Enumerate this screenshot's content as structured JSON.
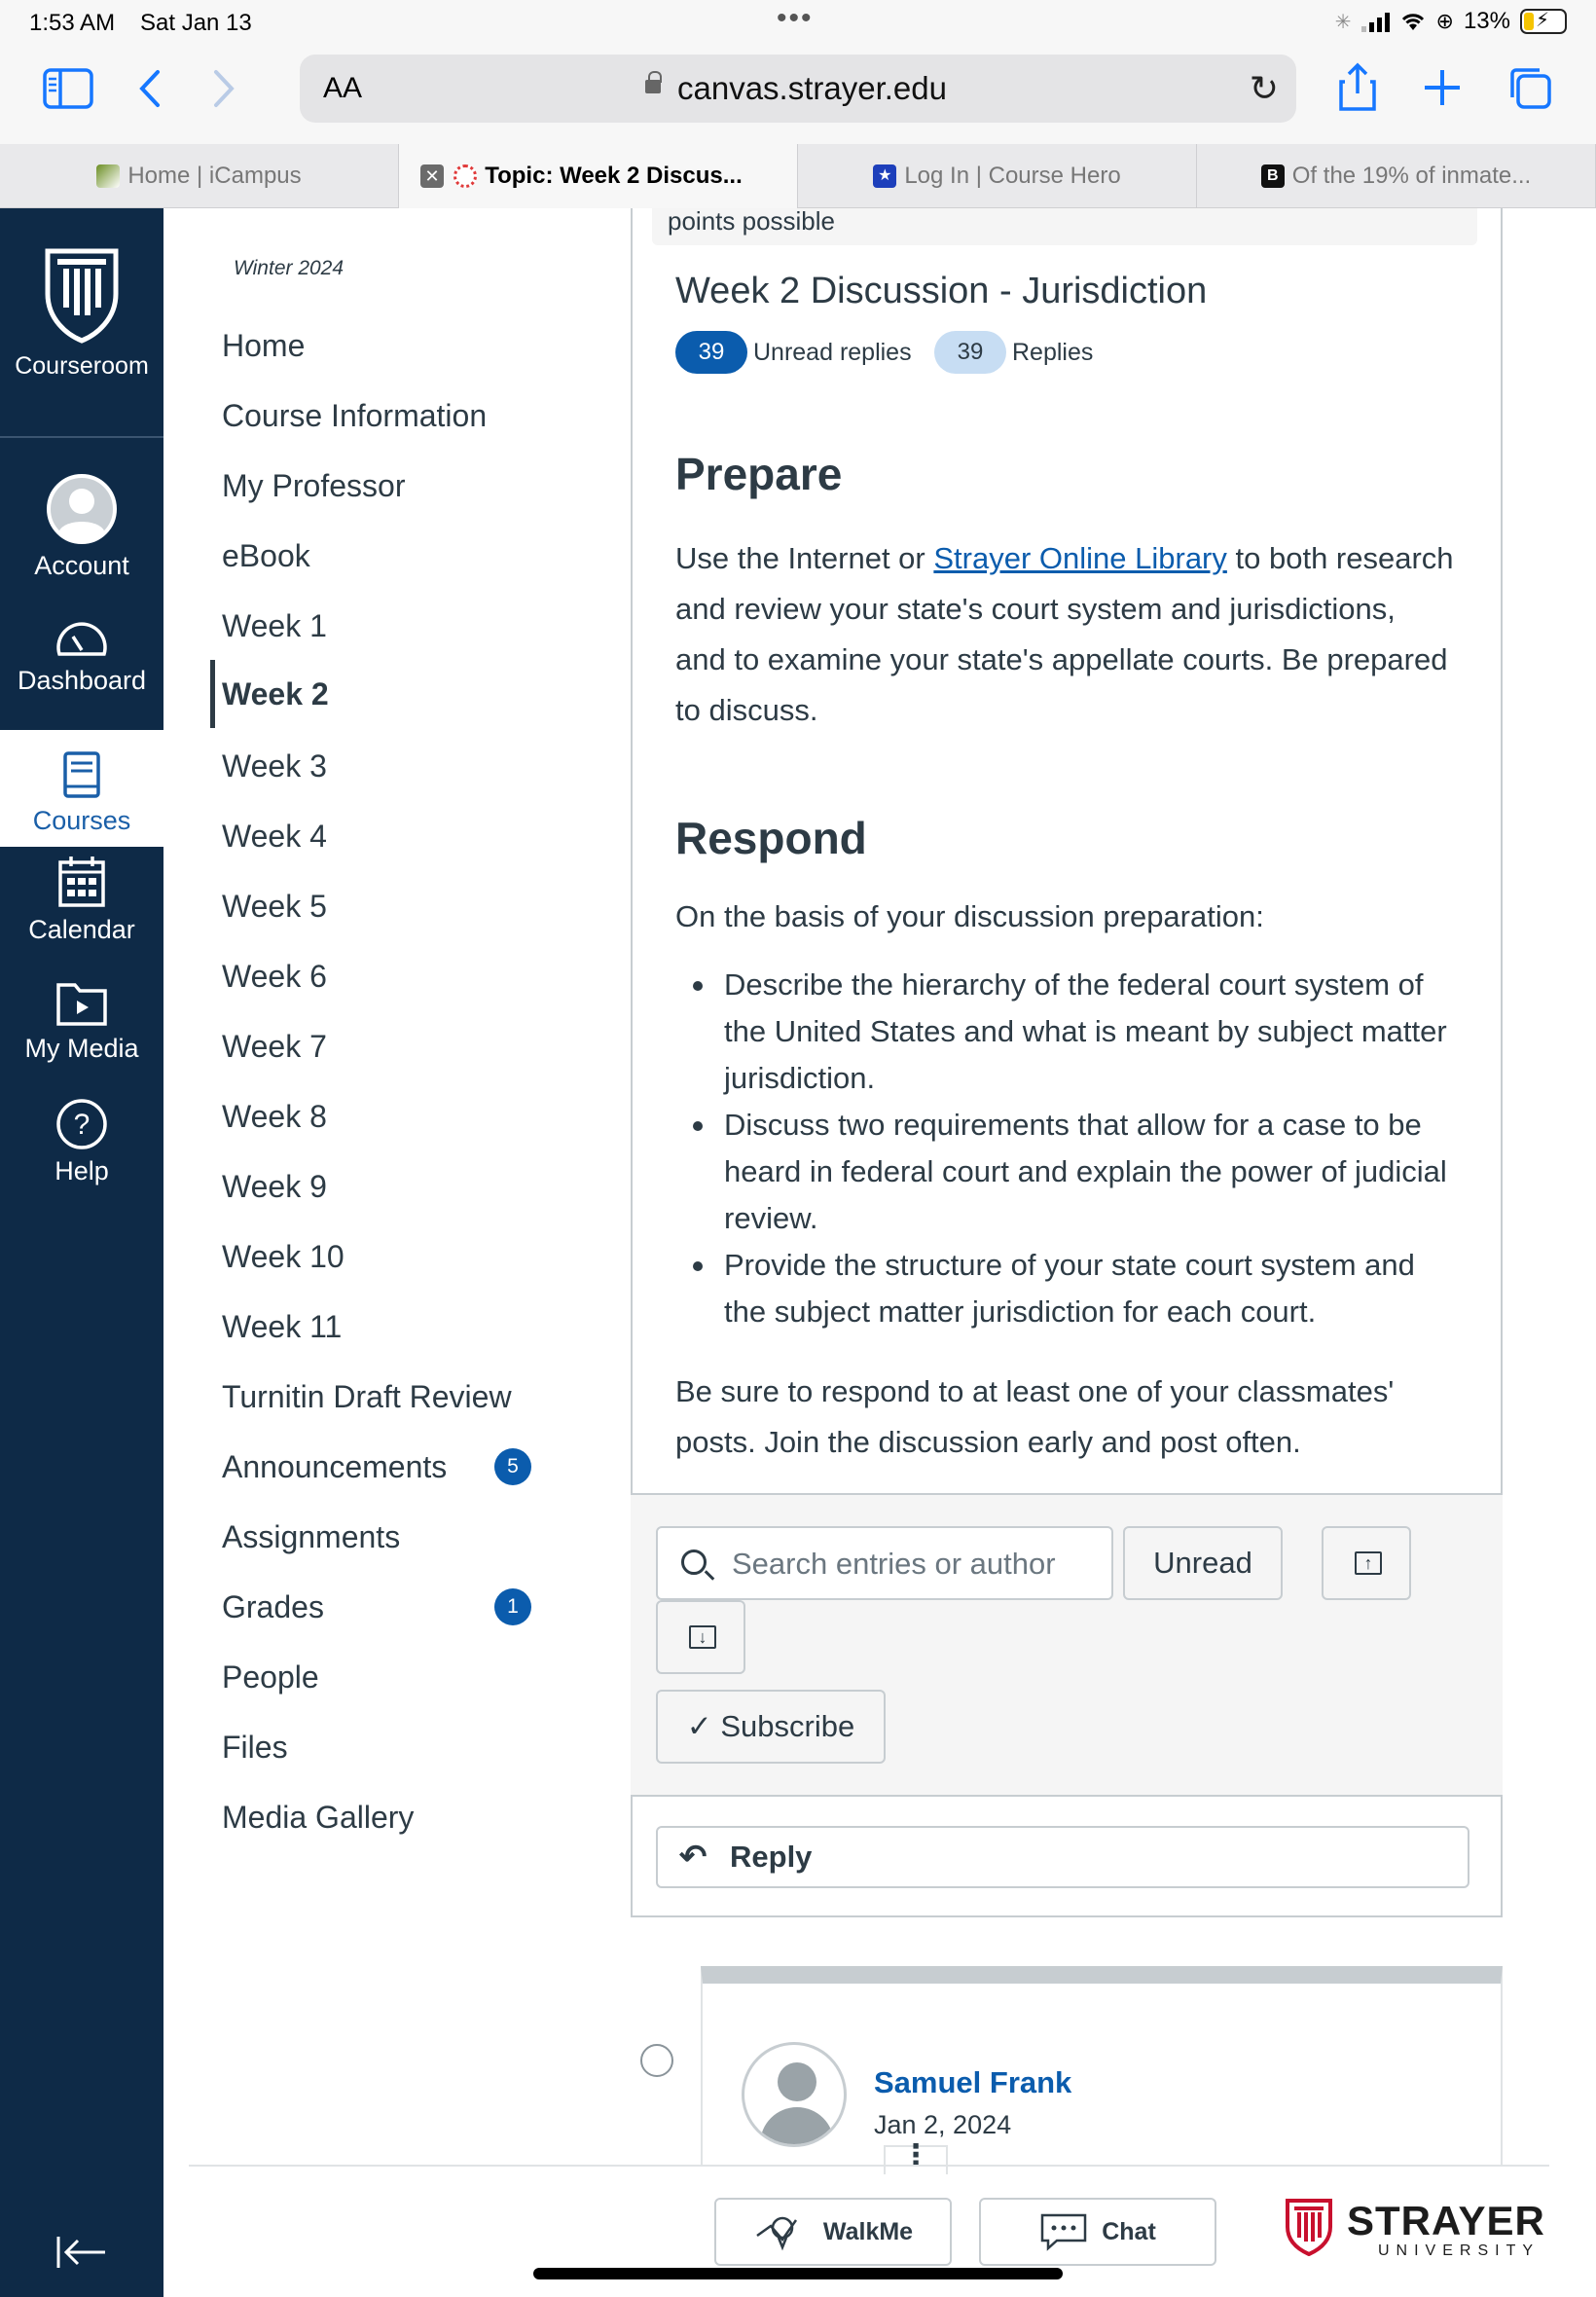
{
  "status_bar": {
    "time": "1:53 AM",
    "date": "Sat Jan 13",
    "battery": "13%"
  },
  "browser": {
    "text_size_label": "AA",
    "url": "canvas.strayer.edu",
    "tabs": [
      {
        "label": "Home | iCampus",
        "active": false
      },
      {
        "label": "Topic: Week 2 Discus...",
        "active": true
      },
      {
        "label": "Log In | Course Hero",
        "active": false
      },
      {
        "label": "Of the 19% of inmate...",
        "active": false
      }
    ]
  },
  "global_nav": {
    "brand_label": "Courseroom",
    "items": [
      {
        "label": "Account",
        "icon": "account-avatar-icon"
      },
      {
        "label": "Dashboard",
        "icon": "dashboard-gauge-icon"
      },
      {
        "label": "Courses",
        "icon": "courses-book-icon",
        "active": true
      },
      {
        "label": "Calendar",
        "icon": "calendar-icon"
      },
      {
        "label": "My Media",
        "icon": "media-folder-icon"
      },
      {
        "label": "Help",
        "icon": "help-question-icon"
      }
    ],
    "collapse_icon": "collapse-arrow-icon"
  },
  "course_nav": {
    "term": "Winter 2024",
    "items": [
      {
        "label": "Home"
      },
      {
        "label": "Course Information"
      },
      {
        "label": "My Professor"
      },
      {
        "label": "eBook"
      },
      {
        "label": "Week 1"
      },
      {
        "label": "Week 2",
        "active": true
      },
      {
        "label": "Week 3"
      },
      {
        "label": "Week 4"
      },
      {
        "label": "Week 5"
      },
      {
        "label": "Week 6"
      },
      {
        "label": "Week 7"
      },
      {
        "label": "Week 8"
      },
      {
        "label": "Week 9"
      },
      {
        "label": "Week 10"
      },
      {
        "label": "Week 11"
      },
      {
        "label": "Turnitin Draft Review"
      },
      {
        "label": "Announcements",
        "badge": "5"
      },
      {
        "label": "Assignments"
      },
      {
        "label": "Grades",
        "badge": "1"
      },
      {
        "label": "People"
      },
      {
        "label": "Files"
      },
      {
        "label": "Media Gallery"
      }
    ]
  },
  "discussion": {
    "points_text": "points possible",
    "title": "Week 2 Discussion - Jurisdiction",
    "unread_count": "39",
    "unread_label": "Unread replies",
    "replies_count": "39",
    "replies_label": "Replies",
    "prepare_heading": "Prepare",
    "prepare_text_before": "Use the Internet or ",
    "prepare_link": "Strayer Online Library",
    "prepare_text_after": " to both research and review your state's court system and jurisdictions, and to examine your state's appellate courts. Be prepared to discuss.",
    "respond_heading": "Respond",
    "respond_intro": "On the basis of your discussion preparation:",
    "bullets": [
      "Describe the hierarchy of the federal court system of the United States and what is meant by subject matter jurisdiction.",
      "Discuss two requirements that allow for a case to be heard in federal court and explain the power of judicial review.",
      "Provide the structure of your state court system and the subject matter jurisdiction for each court."
    ],
    "closing": "Be sure to respond to at least one of your classmates' posts. Join the discussion early and post often."
  },
  "controls": {
    "search_placeholder": "Search entries or author",
    "unread_button": "Unread",
    "subscribe_button": "Subscribe",
    "reply_button": "Reply"
  },
  "first_post": {
    "author": "Samuel Frank",
    "date": "Jan 2, 2024"
  },
  "footer": {
    "walkme_label": "WalkMe",
    "chat_label": "Chat",
    "logo_word": "STRAYER",
    "logo_sub": "UNIVERSITY"
  },
  "colors": {
    "nav_background": "#0e2a47",
    "link_blue": "#0b5cad",
    "text": "#2d3b45",
    "replies_pill": "#c7ddf3"
  }
}
